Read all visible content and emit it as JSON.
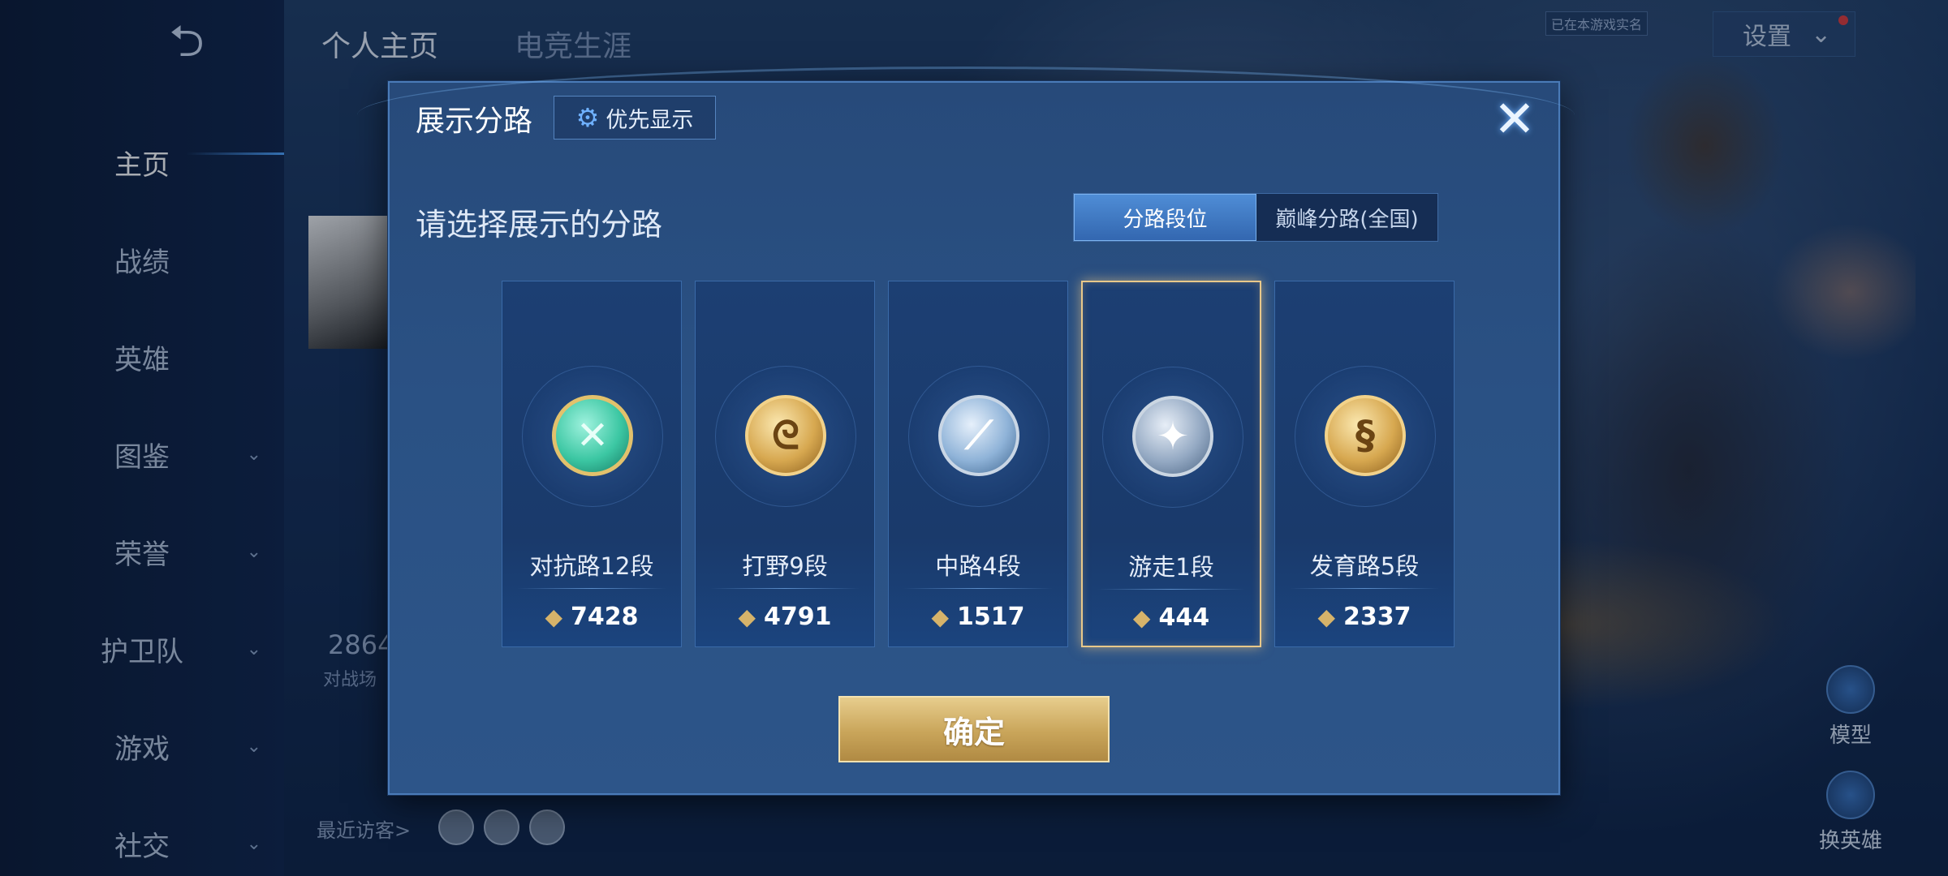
{
  "header": {
    "tabs": [
      {
        "label": "个人主页"
      },
      {
        "label": "电竞生涯"
      }
    ],
    "verify_tag": "已在本游戏实名",
    "settings_label": "设置"
  },
  "sidebar": {
    "items": [
      {
        "label": "主页"
      },
      {
        "label": "战绩"
      },
      {
        "label": "英雄"
      },
      {
        "label": "图鉴"
      },
      {
        "label": "荣誉"
      },
      {
        "label": "护卫队"
      },
      {
        "label": "游戏"
      },
      {
        "label": "社交"
      }
    ]
  },
  "profile_bg": {
    "stat_value": "2864",
    "stat_label": "对战场",
    "visitors_label": "最近访客>"
  },
  "side_buttons": {
    "model": "模型",
    "switch_hero": "换英雄"
  },
  "modal": {
    "title": "展示分路",
    "priority_label": "优先显示",
    "subtitle": "请选择展示的分路",
    "toggle": [
      {
        "label": "分路段位",
        "active": true
      },
      {
        "label": "巅峰分路(全国)",
        "active": false
      }
    ],
    "cards": [
      {
        "label": "对抗路12段",
        "score": "7428",
        "icon": "sword-cross-icon",
        "selected": false
      },
      {
        "label": "打野9段",
        "score": "4791",
        "icon": "dragon-icon",
        "selected": false
      },
      {
        "label": "中路4段",
        "score": "1517",
        "icon": "staff-icon",
        "selected": false
      },
      {
        "label": "游走1段",
        "score": "444",
        "icon": "wings-icon",
        "selected": true
      },
      {
        "label": "发育路5段",
        "score": "2337",
        "icon": "bow-icon",
        "selected": false
      }
    ],
    "confirm_label": "确定"
  }
}
